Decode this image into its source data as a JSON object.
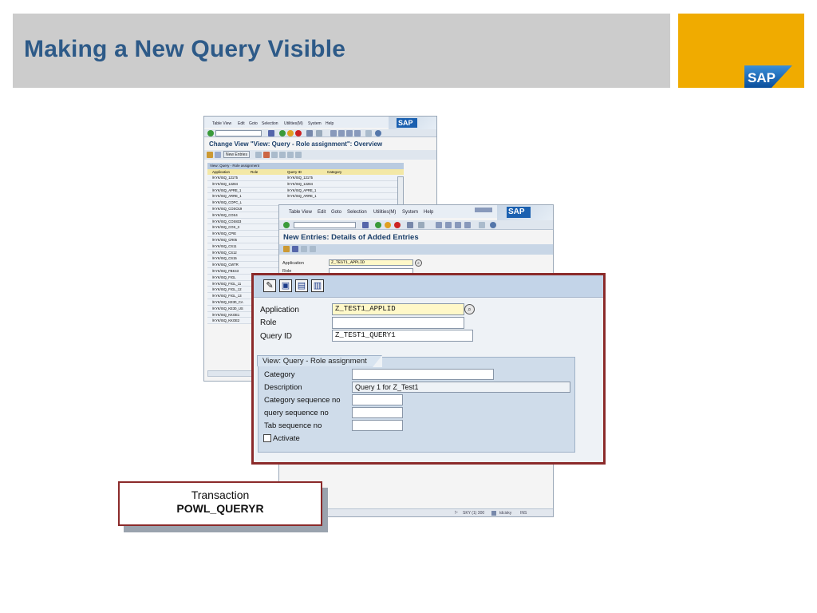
{
  "slide": {
    "title": "Making a New Query Visible",
    "logo_text": "SAP",
    "colors": {
      "title": "#2d5a88",
      "header_bg": "#cccccc",
      "logo_bg": "#f0ab00",
      "highlight_border": "#8b2a2a"
    }
  },
  "window_overview": {
    "menu": [
      "Table View",
      "Edit",
      "Goto",
      "Selection",
      "Utilities(M)",
      "System",
      "Help"
    ],
    "screen_title": "Change View \"View: Query - Role assignment\": Overview",
    "new_entries_button": "New Entries",
    "table": {
      "caption": "View: Query - Role assignment",
      "columns": [
        "Application",
        "Role",
        "Query ID",
        "Category"
      ],
      "rows": [
        [
          "/KYK/ISQ_12175",
          "",
          "/KYK/ISQ_12175",
          ""
        ],
        [
          "/KYK/ISQ_12284",
          "",
          "/KYK/ISQ_12284",
          ""
        ],
        [
          "/KYK/ISQ_APRE_1",
          "",
          "/KYK/ISQ_APRE_1",
          ""
        ],
        [
          "/KYK/ISQ_ARRE_1",
          "",
          "/KYK/ISQ_ARRE_1",
          ""
        ],
        [
          "/KYK/ISQ_COPC_L",
          "",
          "",
          ""
        ],
        [
          "/KYK/ISQ_COSO19",
          "",
          "",
          ""
        ],
        [
          "/KYK/ISQ_COS4",
          "",
          "",
          ""
        ],
        [
          "/KYK/ISQ_COS833",
          "",
          "",
          ""
        ],
        [
          "/KYK/ISQ_COS_3",
          "",
          "",
          ""
        ],
        [
          "/KYK/ISQ_CPIE",
          "",
          "",
          ""
        ],
        [
          "/KYK/ISQ_CR05",
          "",
          "",
          ""
        ],
        [
          "/KYK/ISQ_CS11",
          "",
          "",
          ""
        ],
        [
          "/KYK/ISQ_CS12",
          "",
          "",
          ""
        ],
        [
          "/KYK/ISQ_CS15",
          "",
          "",
          ""
        ],
        [
          "/KYK/ISQ_CWTR",
          "",
          "",
          ""
        ],
        [
          "/KYK/ISQ_FBK43",
          "",
          "",
          ""
        ],
        [
          "/KYK/ISQ_FIGL",
          "",
          "",
          ""
        ],
        [
          "/KYK/ISQ_FIGL_11",
          "",
          "",
          ""
        ],
        [
          "/KYK/ISQ_FIGL_12",
          "",
          "",
          ""
        ],
        [
          "/KYK/ISQ_FIGL_13",
          "",
          "",
          ""
        ],
        [
          "/KYK/ISQ_KE30_CA",
          "",
          "",
          ""
        ],
        [
          "/KYK/ISQ_KE30_US",
          "",
          "",
          ""
        ],
        [
          "/KYK/ISQ_KKOE1",
          "",
          "",
          ""
        ],
        [
          "/KYK/ISQ_KKOE2",
          "",
          "",
          ""
        ]
      ]
    }
  },
  "window_details": {
    "menu": [
      "Table View",
      "Edit",
      "Goto",
      "Selection",
      "Utilities(M)",
      "System",
      "Help"
    ],
    "screen_title": "New Entries: Details of Added Entries",
    "fields": {
      "application_label": "Application",
      "application_value": "Z_TEST1_APPLID",
      "role_label": "Role"
    },
    "status": {
      "system": "SKY (1) 300",
      "user": "tdcisky",
      "mode": "INS"
    }
  },
  "zoom_panel": {
    "application_label": "Application",
    "application_value": "Z_TEST1_APPLID",
    "role_label": "Role",
    "role_value": "",
    "query_id_label": "Query ID",
    "query_id_value": "Z_TEST1_QUERY1",
    "group": {
      "title": "View: Query - Role assignment",
      "category_label": "Category",
      "category_value": "",
      "description_label": "Description",
      "description_value": "Query 1 for Z_Test1",
      "category_seq_label": "Category sequence no",
      "query_seq_label": "query sequence no",
      "tab_seq_label": "Tab sequence no",
      "activate_label": "Activate"
    }
  },
  "callout": {
    "line1": "Transaction",
    "line2": "POWL_QUERYR"
  }
}
